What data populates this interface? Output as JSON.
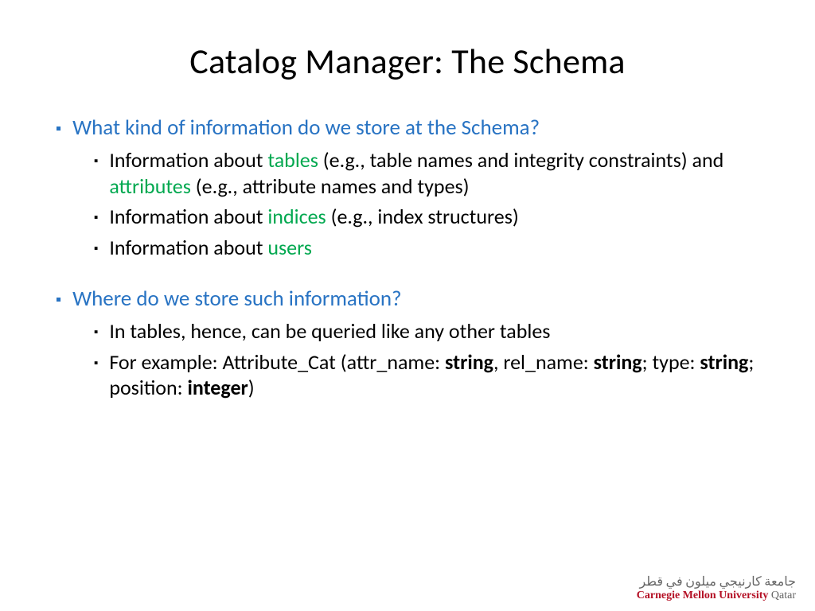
{
  "title": "Catalog Manager: The Schema",
  "q1": "What kind of information do we store at the Schema?",
  "sub1a_parts": [
    "Information about ",
    "tables",
    " (e.g., table names and integrity constraints) and ",
    "attributes",
    " (e.g., attribute names and types)"
  ],
  "sub1b_parts": [
    "Information about ",
    "indices",
    " (e.g., index structures)"
  ],
  "sub1c_parts": [
    "Information about ",
    "users"
  ],
  "q2": "Where do we store such information?",
  "sub2a": "In tables, hence, can be queried like any other tables",
  "sub2b_parts": [
    "For example: Attribute_Cat (attr_name: ",
    "string",
    ", rel_name: ",
    "string",
    "; type: ",
    "string",
    "; position: ",
    "integer",
    ")"
  ],
  "logo": {
    "arabic": "جامعة كارنيجي ميلون في قطر",
    "cmu": "Carnegie Mellon University",
    "qatar": " Qatar"
  }
}
